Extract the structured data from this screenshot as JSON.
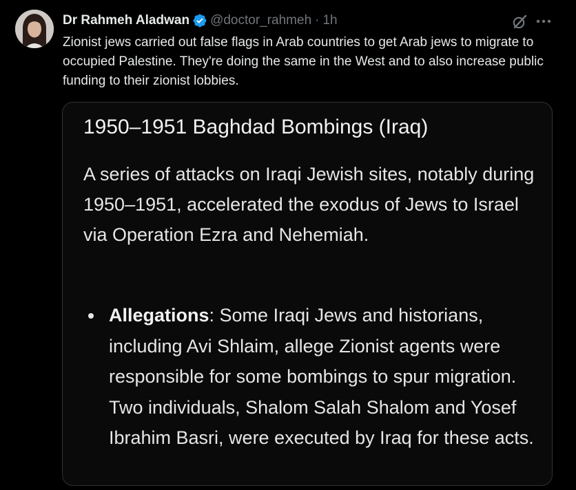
{
  "post": {
    "author_name": "Dr Rahmeh Aladwan",
    "handle": "@doctor_rahmeh",
    "separator": "·",
    "time": "1h",
    "text": "Zionist jews carried out false flags in Arab countries to get Arab jews to migrate to occupied Palestine. They're doing the same in the West and to also increase public funding to their zionist lobbies."
  },
  "card": {
    "title": "1950–1951 Baghdad Bombings (Iraq)",
    "body": "A series of attacks on Iraqi Jewish sites, notably during 1950–1951, accelerated the exodus of Jews to Israel via Operation Ezra and Nehemiah.",
    "bullets": [
      {
        "term": "Allegations",
        "text": ": Some Iraqi Jews and historians, including Avi Shlaim, allege Zionist agents were responsible for some bombings to spur migration. Two individuals, Shalom Salah Shalom and Yosef Ibrahim Basri, were executed by Iraq for these acts."
      }
    ]
  },
  "icons": {
    "verified": "verified-badge-icon",
    "grok": "grok-icon",
    "more": "more-options-icon"
  },
  "colors": {
    "background": "#000000",
    "text_primary": "#e7e9ea",
    "text_secondary": "#71767b",
    "verified_blue": "#1d9bf0",
    "card_border": "#2f3336"
  }
}
